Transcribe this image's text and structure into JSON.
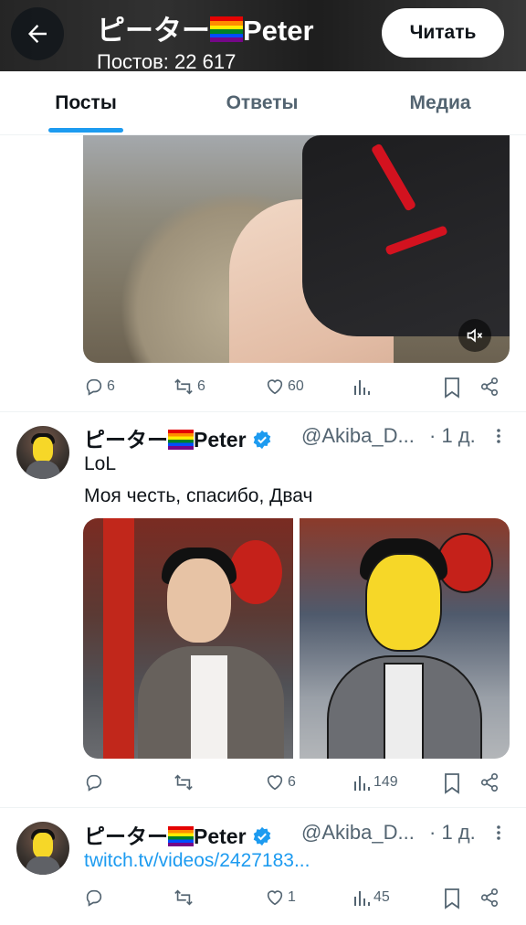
{
  "header": {
    "name": "ピーター",
    "name_suffix": "Peter",
    "posts_count": "Постов: 22 617",
    "follow_label": "Читать"
  },
  "tabs": [
    {
      "label": "Посты",
      "active": true
    },
    {
      "label": "Ответы",
      "active": false
    },
    {
      "label": "Медиа",
      "active": false
    }
  ],
  "tweets": [
    {
      "media": "video",
      "stats": {
        "replies": "6",
        "retweets": "6",
        "likes": "60",
        "views": ""
      }
    },
    {
      "author": "ピーター",
      "author_suffix": "Peter",
      "handle": "@Akiba_D...",
      "time": "· 1 д.",
      "text_lines": [
        "LoL",
        "Моя честь, спасибо, Двач"
      ],
      "media": "two-images",
      "stats": {
        "replies": "",
        "retweets": "",
        "likes": "6",
        "views": "149"
      }
    },
    {
      "author": "ピーター",
      "author_suffix": "Peter",
      "handle": "@Akiba_D...",
      "time": "· 1 д.",
      "link": "twitch.tv/videos/2427183...",
      "stats": {
        "replies": "",
        "retweets": "",
        "likes": "1",
        "views": "45"
      }
    }
  ],
  "colors": {
    "accent": "#1d9bf0",
    "text_primary": "#0f1419",
    "text_secondary": "#536471",
    "verified": "#1d9bf0"
  },
  "icons": [
    "back-arrow-icon",
    "rainbow-flag-icon",
    "verified-badge-icon",
    "more-icon",
    "reply-icon",
    "retweet-icon",
    "like-icon",
    "views-icon",
    "bookmark-icon",
    "share-icon",
    "mute-icon"
  ]
}
